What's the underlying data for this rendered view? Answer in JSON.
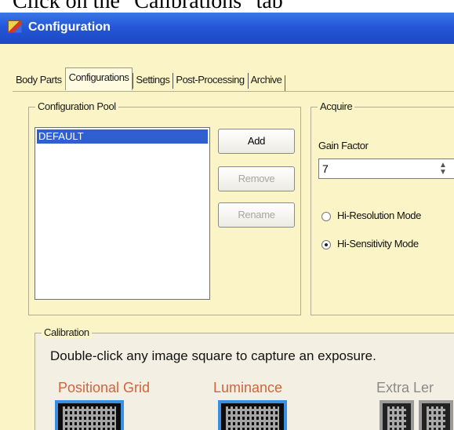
{
  "caption": "Click on the \"Calibrations\" tab",
  "window": {
    "title": "Configuration"
  },
  "tabs": [
    {
      "label": "Body Parts"
    },
    {
      "label": "Configurations"
    },
    {
      "label": "Settings"
    },
    {
      "label": "Post-Processing"
    },
    {
      "label": "Archive"
    }
  ],
  "config_pool": {
    "title": "Configuration Pool",
    "items": [
      "DEFAULT"
    ],
    "add_label": "Add",
    "remove_label": "Remove",
    "rename_label": "Rename"
  },
  "acquire": {
    "title": "Acquire",
    "gain_label": "Gain Factor",
    "gain_value": "7",
    "mode_hires": "Hi-Resolution Mode",
    "mode_hisens": "Hi-Sensitivity Mode",
    "selected_mode": "Hi-Sensitivity Mode"
  },
  "calibration": {
    "title": "Calibration",
    "hint": "Double-click any image square to capture an exposure.",
    "positional_label": "Positional Grid",
    "luminance_label": "Luminance",
    "extra_label": "Extra Ler"
  },
  "colors": {
    "titlebar": "#2457d8",
    "positional_label": "#d0643a",
    "luminance_label": "#d0643a",
    "extra_label": "#8a8a8a"
  }
}
